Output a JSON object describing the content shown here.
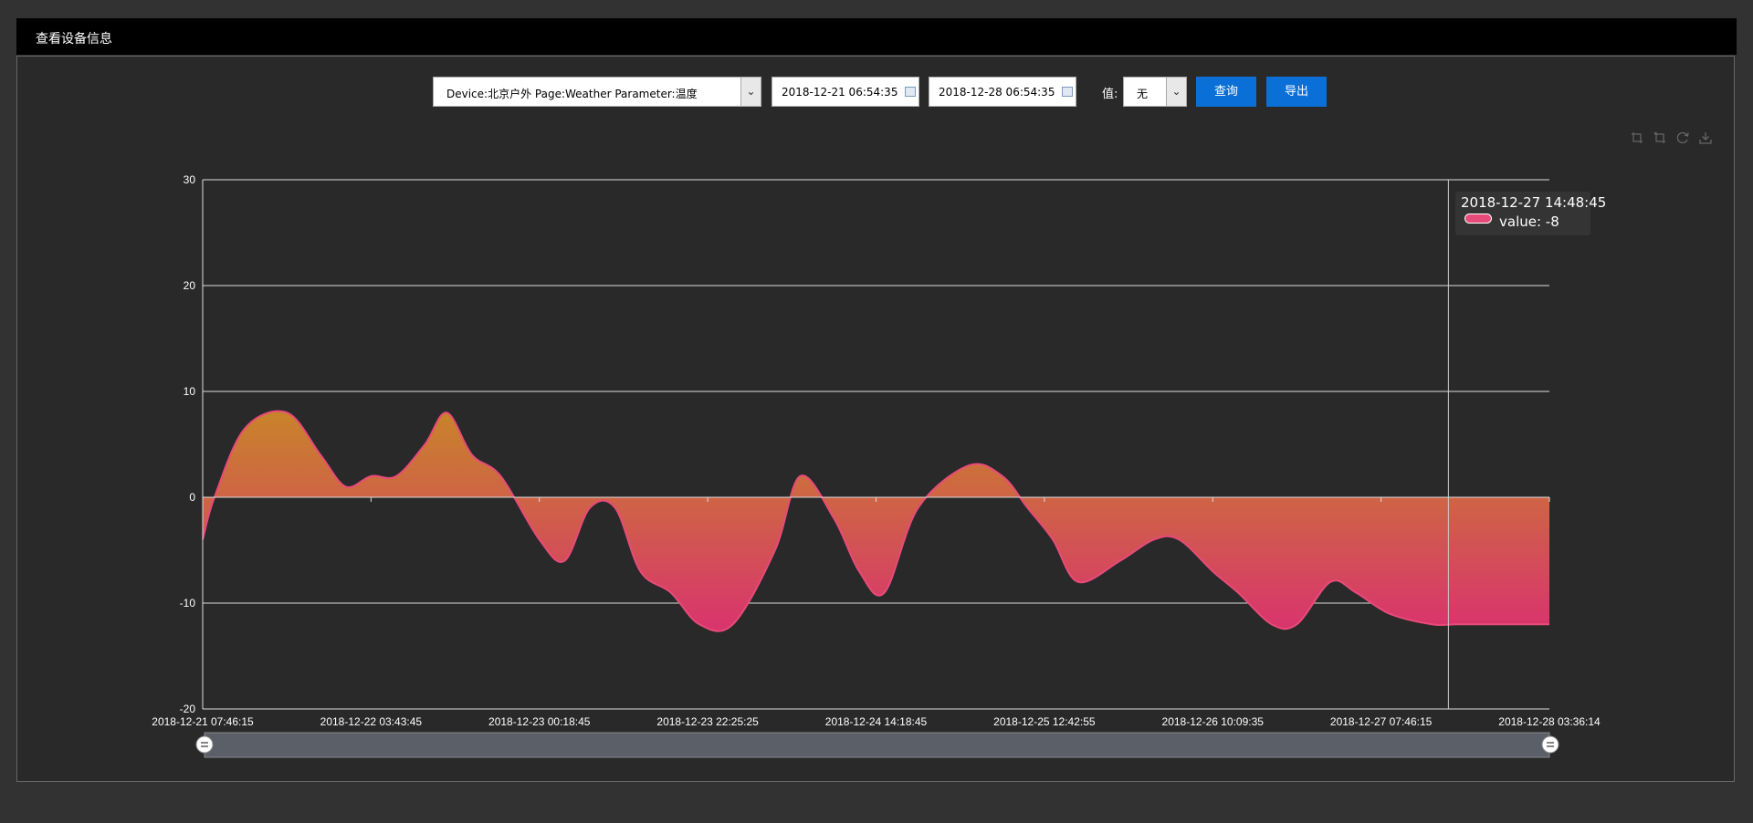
{
  "window": {
    "title": "查看设备信息"
  },
  "controls": {
    "device_select": "Device:北京户外 Page:Weather Parameter:温度",
    "start_date": "2018-12-21 06:54:35",
    "end_date": "2018-12-28 06:54:35",
    "value_label": "值:",
    "value_select": "无",
    "query_label": "查询",
    "export_label": "导出"
  },
  "toolbox": [
    "zoom-icon",
    "zoom-reset-icon",
    "restore-icon",
    "download-icon"
  ],
  "tooltip": {
    "time": "2018-12-27 14:48:45",
    "value_text": "value: -8"
  },
  "colors": {
    "line": "#e84a7a",
    "area_top": "#c8842a",
    "area_bottom": "#d9336e"
  },
  "chart_data": {
    "type": "area",
    "ylim": [
      -20,
      30
    ],
    "yticks": [
      -20,
      -10,
      0,
      10,
      20,
      30
    ],
    "xtick_labels": [
      "2018-12-21 07:46:15",
      "2018-12-22 03:43:45",
      "2018-12-23 00:18:45",
      "2018-12-23 22:25:25",
      "2018-12-24 14:18:45",
      "2018-12-25 12:42:55",
      "2018-12-26 10:09:35",
      "2018-12-27 07:46:15",
      "2018-12-28 03:36:14"
    ],
    "x": [
      0,
      0.07,
      0.25,
      0.5,
      0.7,
      0.85,
      1.0,
      1.15,
      1.32,
      1.45,
      1.6,
      1.77,
      2.0,
      2.15,
      2.3,
      2.45,
      2.6,
      2.78,
      2.95,
      3.15,
      3.4,
      3.55,
      3.75,
      3.9,
      4.05,
      4.25,
      4.55,
      4.75,
      4.9,
      5.05,
      5.2,
      5.45,
      5.65,
      5.8,
      6.0,
      6.15,
      6.35,
      6.5,
      6.7,
      6.85,
      7.05,
      7.3,
      7.45,
      7.6,
      7.8,
      8.0
    ],
    "values": [
      -4,
      0,
      6.5,
      8,
      4,
      1,
      2,
      2,
      5,
      8,
      4,
      2,
      -4,
      -6,
      -1,
      -1,
      -7,
      -9,
      -12,
      -12,
      -5,
      2,
      -2,
      -7,
      -9,
      -1,
      3,
      2,
      -1,
      -4,
      -8,
      -6,
      -4,
      -4,
      -7,
      -9,
      -12,
      -12,
      -8,
      -9,
      -11,
      -12,
      -12,
      -12,
      -12,
      -12
    ],
    "crosshair_x": 7.4
  }
}
